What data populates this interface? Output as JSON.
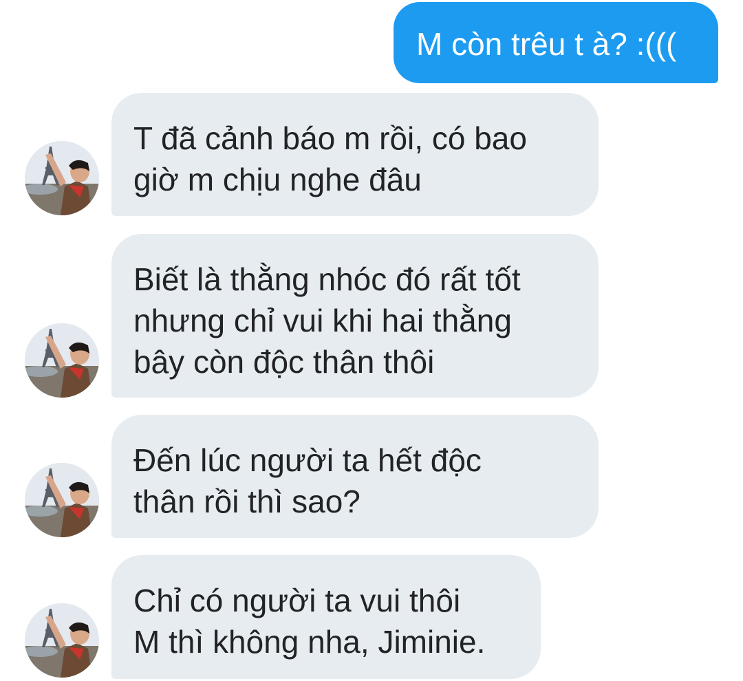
{
  "conversation": {
    "messages": [
      {
        "direction": "sent",
        "text": "M còn trêu t à? :((("
      },
      {
        "direction": "received",
        "text": "T đã cảnh báo m rồi, có bao\ngiờ m chịu nghe đâu"
      },
      {
        "direction": "received",
        "text": "Biết là thằng nhóc đó rất tốt\nnhưng chỉ vui khi hai thằng\nbây còn độc thân thôi"
      },
      {
        "direction": "received",
        "text": "Đến lúc người ta hết độc\nthân rồi thì sao?"
      },
      {
        "direction": "received",
        "text": "Chỉ có người ta vui thôi\nM thì không nha, Jiminie."
      }
    ]
  },
  "colors": {
    "sent_bubble": "#1d9bf0",
    "received_bubble": "#e6ecf0",
    "received_text": "#222326"
  },
  "icons": {
    "avatar": "profile-photo-eiffel-tower"
  }
}
